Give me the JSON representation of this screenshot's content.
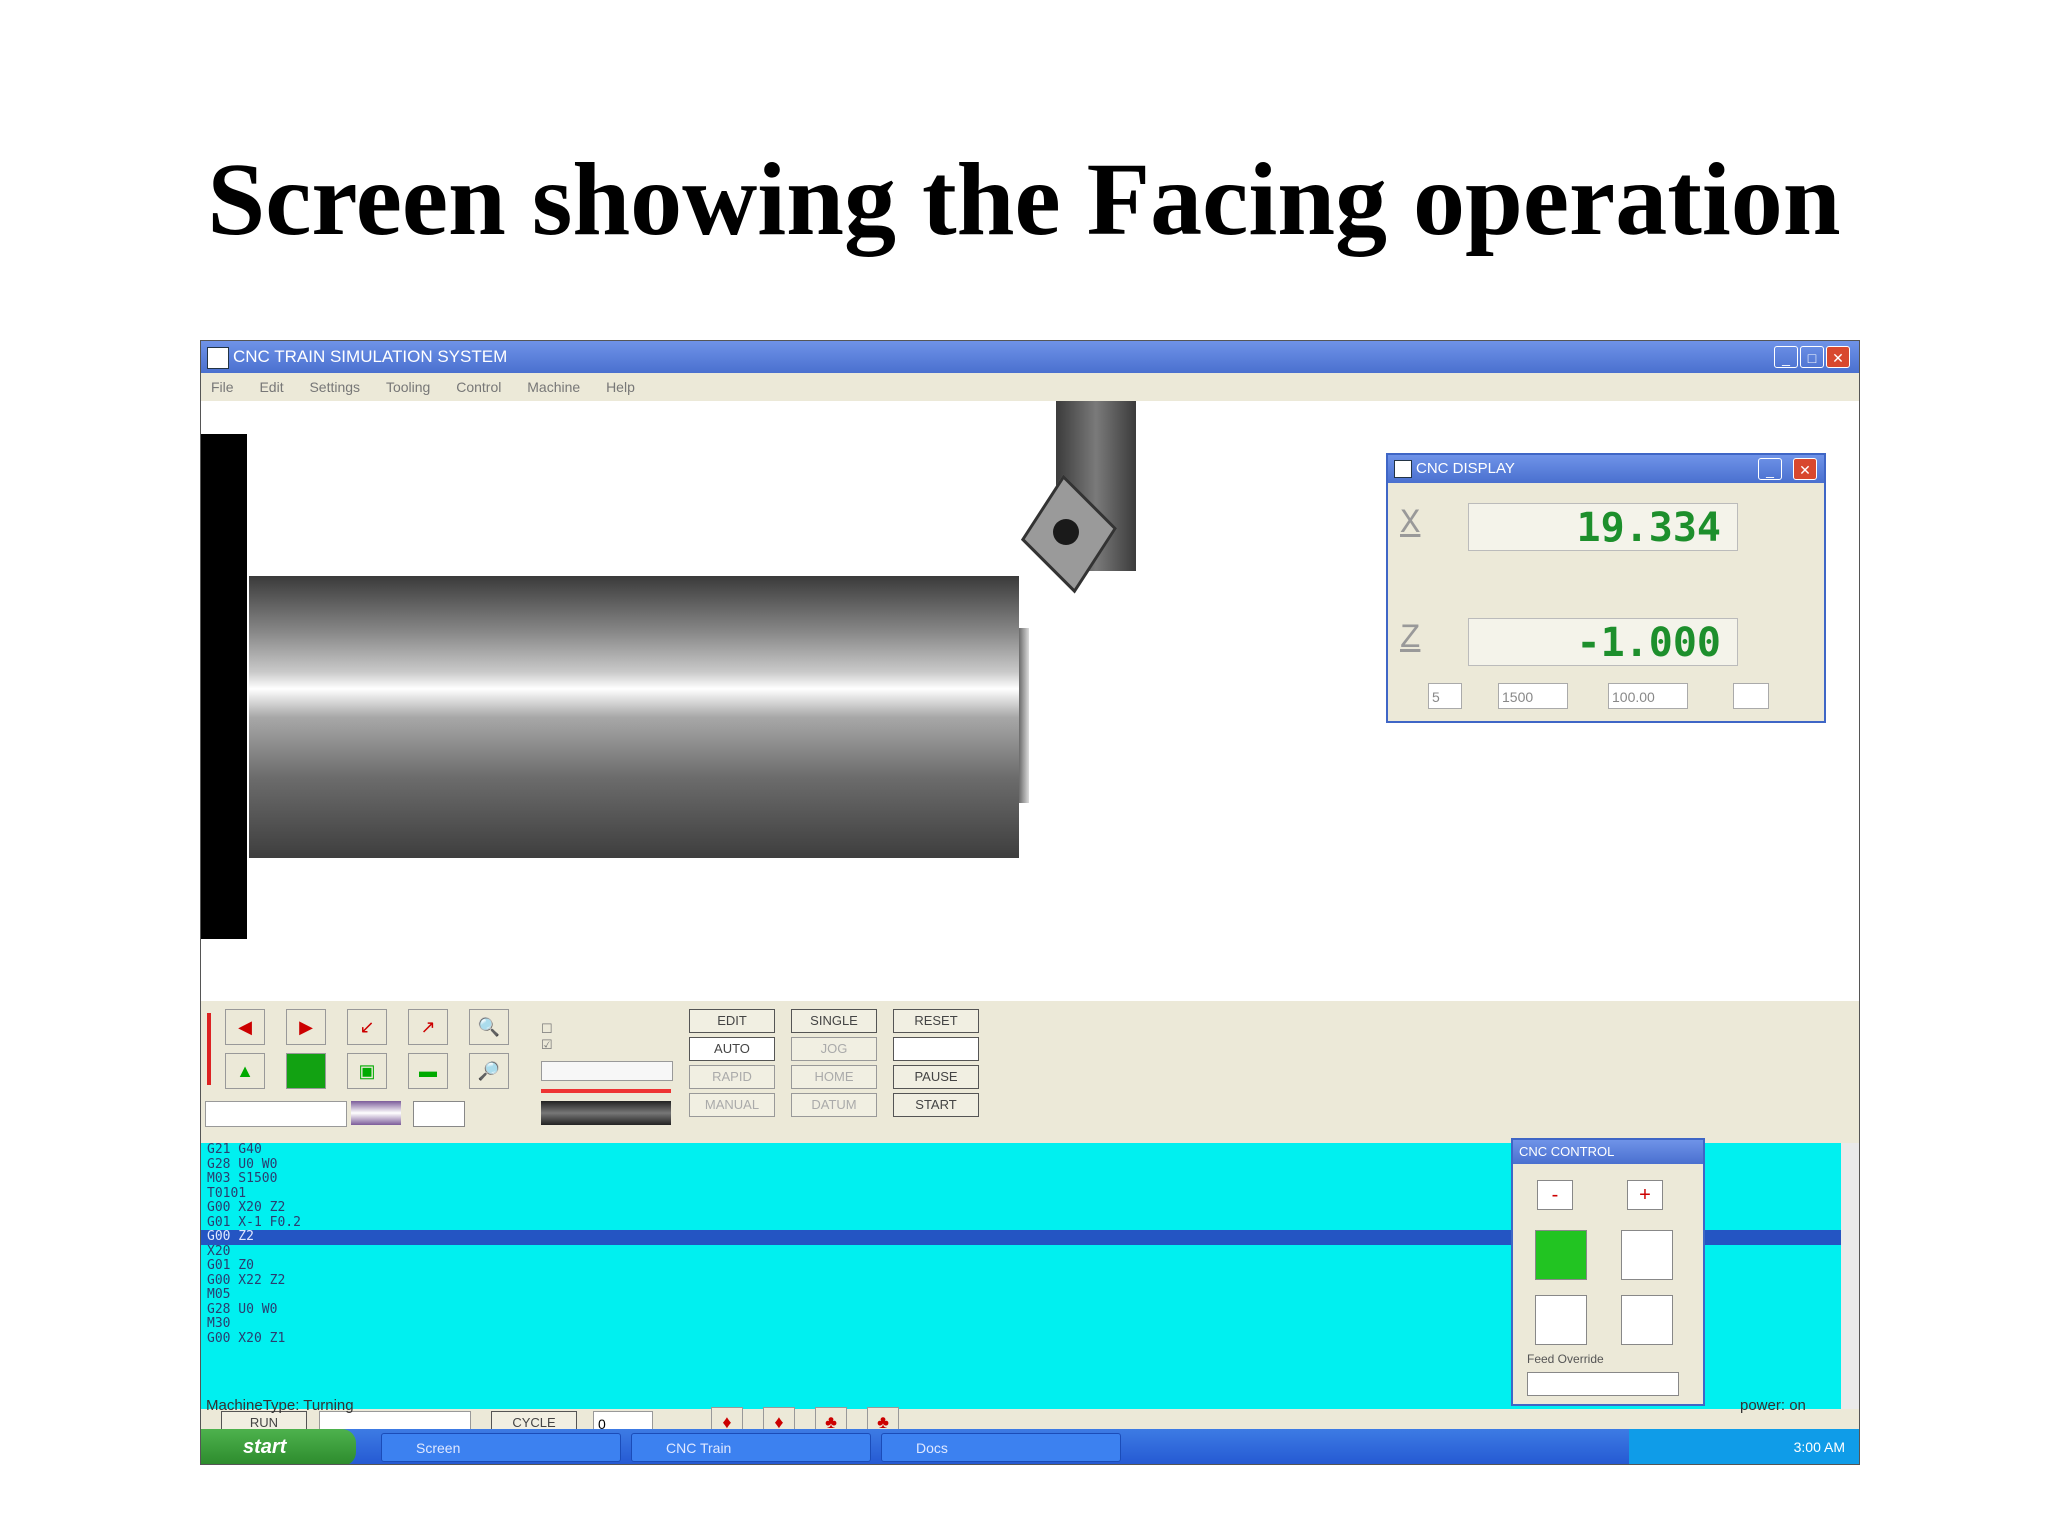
{
  "slide": {
    "title": "Screen showing the Facing operation"
  },
  "window": {
    "title": "CNC TRAIN SIMULATION SYSTEM",
    "menu": [
      "File",
      "Edit",
      "Settings",
      "Tooling",
      "Control",
      "Machine",
      "Help"
    ]
  },
  "dro": {
    "title": "CNC DISPLAY",
    "x_label": "X",
    "x_value": "19.334",
    "z_label": "Z",
    "z_value": "-1.000",
    "fields": [
      "5",
      "1500",
      "100.00",
      ""
    ]
  },
  "controls": {
    "mode_buttons": [
      "EDIT",
      "SINGLE",
      "RESET",
      "AUTO",
      "JOG",
      "",
      "RAPID",
      "HOME",
      "PAUSE",
      "MANUAL",
      "DATUM",
      "START"
    ]
  },
  "program": {
    "lines": [
      "G21 G40",
      "G28 U0 W0",
      "M03 S1500",
      "T0101",
      "G00 X20 Z2",
      "G01 X-1 F0.2",
      "G00 Z2",
      "X20",
      "G01 Z0",
      "G00 X22 Z2",
      "M05",
      "G28 U0 W0",
      "M30",
      "G00 X20 Z1"
    ],
    "selected_index": 6
  },
  "panel": {
    "title": "CNC CONTROL",
    "minus": "-",
    "plus": "+",
    "footer": "Feed Override"
  },
  "bottom": {
    "run_label": "RUN",
    "input_value": "",
    "cycle_label": "CYCLE",
    "count_value": "0"
  },
  "status": {
    "left": "MachineType: Turning",
    "right": "power: on"
  },
  "taskbar": {
    "start": "start",
    "tasks": [
      "Screen",
      "CNC Train",
      "Docs"
    ],
    "time": "3:00 AM"
  }
}
